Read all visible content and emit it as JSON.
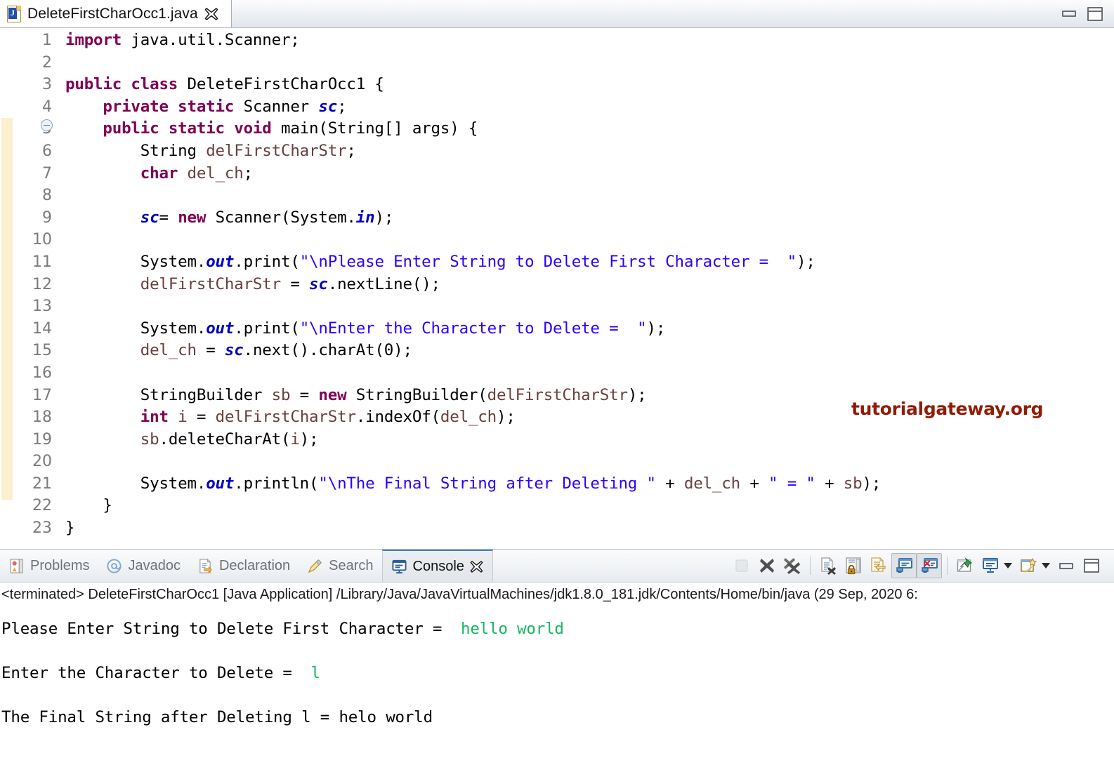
{
  "editor": {
    "tab": {
      "filename": "DeleteFirstCharOcc1.java",
      "icon": "java-file-icon",
      "close_icon": "close-icon"
    },
    "window_buttons": {
      "minimize": "minimize-icon",
      "maximize": "maximize-icon"
    },
    "line_numbers": [
      "1",
      "2",
      "3",
      "4",
      "5",
      "6",
      "7",
      "8",
      "9",
      "10",
      "11",
      "12",
      "13",
      "14",
      "15",
      "16",
      "17",
      "18",
      "19",
      "20",
      "21",
      "22",
      "23"
    ],
    "fold_marker_line": "5",
    "code_lines": [
      {
        "n": 1,
        "tokens": [
          {
            "t": "kw",
            "v": "import"
          },
          {
            "t": "pl",
            "v": " java.util.Scanner;"
          }
        ]
      },
      {
        "n": 2,
        "tokens": []
      },
      {
        "n": 3,
        "tokens": [
          {
            "t": "kw",
            "v": "public class"
          },
          {
            "t": "pl",
            "v": " DeleteFirstCharOcc1 {"
          }
        ]
      },
      {
        "n": 4,
        "tokens": [
          {
            "t": "pl",
            "v": "    "
          },
          {
            "t": "kw",
            "v": "private static"
          },
          {
            "t": "pl",
            "v": " Scanner "
          },
          {
            "t": "fld",
            "v": "sc"
          },
          {
            "t": "pl",
            "v": ";"
          }
        ]
      },
      {
        "n": 5,
        "tokens": [
          {
            "t": "pl",
            "v": "    "
          },
          {
            "t": "kw",
            "v": "public static void"
          },
          {
            "t": "pl",
            "v": " main(String[] args) {"
          }
        ]
      },
      {
        "n": 6,
        "tokens": [
          {
            "t": "pl",
            "v": "        String "
          },
          {
            "t": "loc",
            "v": "delFirstCharStr"
          },
          {
            "t": "pl",
            "v": ";"
          }
        ]
      },
      {
        "n": 7,
        "tokens": [
          {
            "t": "pl",
            "v": "        "
          },
          {
            "t": "kw",
            "v": "char"
          },
          {
            "t": "pl",
            "v": " "
          },
          {
            "t": "loc",
            "v": "del_ch"
          },
          {
            "t": "pl",
            "v": ";"
          }
        ]
      },
      {
        "n": 8,
        "tokens": []
      },
      {
        "n": 9,
        "tokens": [
          {
            "t": "pl",
            "v": "        "
          },
          {
            "t": "fld",
            "v": "sc"
          },
          {
            "t": "pl",
            "v": "= "
          },
          {
            "t": "kw",
            "v": "new"
          },
          {
            "t": "pl",
            "v": " Scanner(System."
          },
          {
            "t": "fld",
            "v": "in"
          },
          {
            "t": "pl",
            "v": ");"
          }
        ]
      },
      {
        "n": 10,
        "tokens": []
      },
      {
        "n": 11,
        "tokens": [
          {
            "t": "pl",
            "v": "        System."
          },
          {
            "t": "fld",
            "v": "out"
          },
          {
            "t": "pl",
            "v": ".print("
          },
          {
            "t": "str",
            "v": "\"\\nPlease Enter String to Delete First Character =  \""
          },
          {
            "t": "pl",
            "v": ");"
          }
        ]
      },
      {
        "n": 12,
        "tokens": [
          {
            "t": "pl",
            "v": "        "
          },
          {
            "t": "loc",
            "v": "delFirstCharStr"
          },
          {
            "t": "pl",
            "v": " = "
          },
          {
            "t": "fld",
            "v": "sc"
          },
          {
            "t": "pl",
            "v": ".nextLine();"
          }
        ]
      },
      {
        "n": 13,
        "tokens": []
      },
      {
        "n": 14,
        "tokens": [
          {
            "t": "pl",
            "v": "        System."
          },
          {
            "t": "fld",
            "v": "out"
          },
          {
            "t": "pl",
            "v": ".print("
          },
          {
            "t": "str",
            "v": "\"\\nEnter the Character to Delete =  \""
          },
          {
            "t": "pl",
            "v": ");"
          }
        ]
      },
      {
        "n": 15,
        "tokens": [
          {
            "t": "pl",
            "v": "        "
          },
          {
            "t": "loc",
            "v": "del_ch"
          },
          {
            "t": "pl",
            "v": " = "
          },
          {
            "t": "fld",
            "v": "sc"
          },
          {
            "t": "pl",
            "v": ".next().charAt(0);"
          }
        ]
      },
      {
        "n": 16,
        "tokens": []
      },
      {
        "n": 17,
        "tokens": [
          {
            "t": "pl",
            "v": "        StringBuilder "
          },
          {
            "t": "loc",
            "v": "sb"
          },
          {
            "t": "pl",
            "v": " = "
          },
          {
            "t": "kw",
            "v": "new"
          },
          {
            "t": "pl",
            "v": " StringBuilder("
          },
          {
            "t": "loc",
            "v": "delFirstCharStr"
          },
          {
            "t": "pl",
            "v": ");"
          }
        ]
      },
      {
        "n": 18,
        "tokens": [
          {
            "t": "pl",
            "v": "        "
          },
          {
            "t": "kw",
            "v": "int"
          },
          {
            "t": "pl",
            "v": " "
          },
          {
            "t": "loc",
            "v": "i"
          },
          {
            "t": "pl",
            "v": " = "
          },
          {
            "t": "loc",
            "v": "delFirstCharStr"
          },
          {
            "t": "pl",
            "v": ".indexOf("
          },
          {
            "t": "loc",
            "v": "del_ch"
          },
          {
            "t": "pl",
            "v": ");"
          }
        ]
      },
      {
        "n": 19,
        "tokens": [
          {
            "t": "pl",
            "v": "        "
          },
          {
            "t": "loc",
            "v": "sb"
          },
          {
            "t": "pl",
            "v": ".deleteCharAt("
          },
          {
            "t": "loc",
            "v": "i"
          },
          {
            "t": "pl",
            "v": ");"
          }
        ]
      },
      {
        "n": 20,
        "tokens": []
      },
      {
        "n": 21,
        "tokens": [
          {
            "t": "pl",
            "v": "        System."
          },
          {
            "t": "fld",
            "v": "out"
          },
          {
            "t": "pl",
            "v": ".println("
          },
          {
            "t": "str",
            "v": "\"\\nThe Final String after Deleting \""
          },
          {
            "t": "pl",
            "v": " + "
          },
          {
            "t": "loc",
            "v": "del_ch"
          },
          {
            "t": "pl",
            "v": " + "
          },
          {
            "t": "str",
            "v": "\" = \""
          },
          {
            "t": "pl",
            "v": " + "
          },
          {
            "t": "loc",
            "v": "sb"
          },
          {
            "t": "pl",
            "v": ");"
          }
        ]
      },
      {
        "n": 22,
        "tokens": [
          {
            "t": "pl",
            "v": "    }"
          }
        ]
      },
      {
        "n": 23,
        "tokens": [
          {
            "t": "pl",
            "v": "}"
          }
        ]
      }
    ]
  },
  "watermark": {
    "text": "tutorialgateway.org",
    "color": "#8f1d06"
  },
  "console": {
    "tabs": [
      {
        "label": "Problems",
        "icon": "problems-icon",
        "active": false
      },
      {
        "label": "Javadoc",
        "icon": "javadoc-at-icon",
        "active": false
      },
      {
        "label": "Declaration",
        "icon": "declaration-icon",
        "active": false
      },
      {
        "label": "Search",
        "icon": "search-pencil-icon",
        "active": false
      },
      {
        "label": "Console",
        "icon": "console-icon",
        "active": true
      }
    ],
    "toolbar": [
      {
        "name": "terminate-button",
        "icon": "stop-square-icon",
        "enabled": false
      },
      {
        "name": "remove-launch-button",
        "icon": "x-icon",
        "enabled": true
      },
      {
        "name": "remove-all-launches-button",
        "icon": "double-x-icon",
        "enabled": true
      },
      {
        "name": "clear-console-button",
        "icon": "clear-console-icon",
        "enabled": true
      },
      {
        "name": "scroll-lock-button",
        "icon": "scroll-lock-icon",
        "enabled": true
      },
      {
        "name": "word-wrap-button",
        "icon": "word-wrap-icon",
        "enabled": true
      },
      {
        "name": "show-console-on-output-button",
        "icon": "show-console-stdout-icon",
        "enabled": true,
        "pressed": true
      },
      {
        "name": "show-console-on-error-button",
        "icon": "show-console-stderr-icon",
        "enabled": true,
        "pressed": true
      },
      {
        "name": "pin-console-button",
        "icon": "pin-icon",
        "enabled": true
      },
      {
        "name": "display-selected-console-button",
        "icon": "display-console-icon",
        "enabled": true,
        "has_dropdown": true
      },
      {
        "name": "open-console-button",
        "icon": "new-console-icon",
        "enabled": true,
        "has_dropdown": true
      },
      {
        "name": "minimize-button",
        "icon": "minimize-icon",
        "enabled": true
      },
      {
        "name": "maximize-button",
        "icon": "maximize-icon",
        "enabled": true
      }
    ],
    "status_line": "<terminated> DeleteFirstCharOcc1 [Java Application] /Library/Java/JavaVirtualMachines/jdk1.8.0_181.jdk/Contents/Home/bin/java  (29 Sep, 2020 6:",
    "output": [
      {
        "segments": [
          {
            "t": "out",
            "v": "Please Enter String to Delete First Character =  "
          },
          {
            "t": "in",
            "v": "hello world"
          }
        ]
      },
      {
        "segments": [
          {
            "t": "out",
            "v": ""
          }
        ]
      },
      {
        "segments": [
          {
            "t": "out",
            "v": "Enter the Character to Delete =  "
          },
          {
            "t": "in",
            "v": "l"
          }
        ]
      },
      {
        "segments": [
          {
            "t": "out",
            "v": ""
          }
        ]
      },
      {
        "segments": [
          {
            "t": "out",
            "v": "The Final String after Deleting l = helo world"
          }
        ]
      }
    ]
  }
}
